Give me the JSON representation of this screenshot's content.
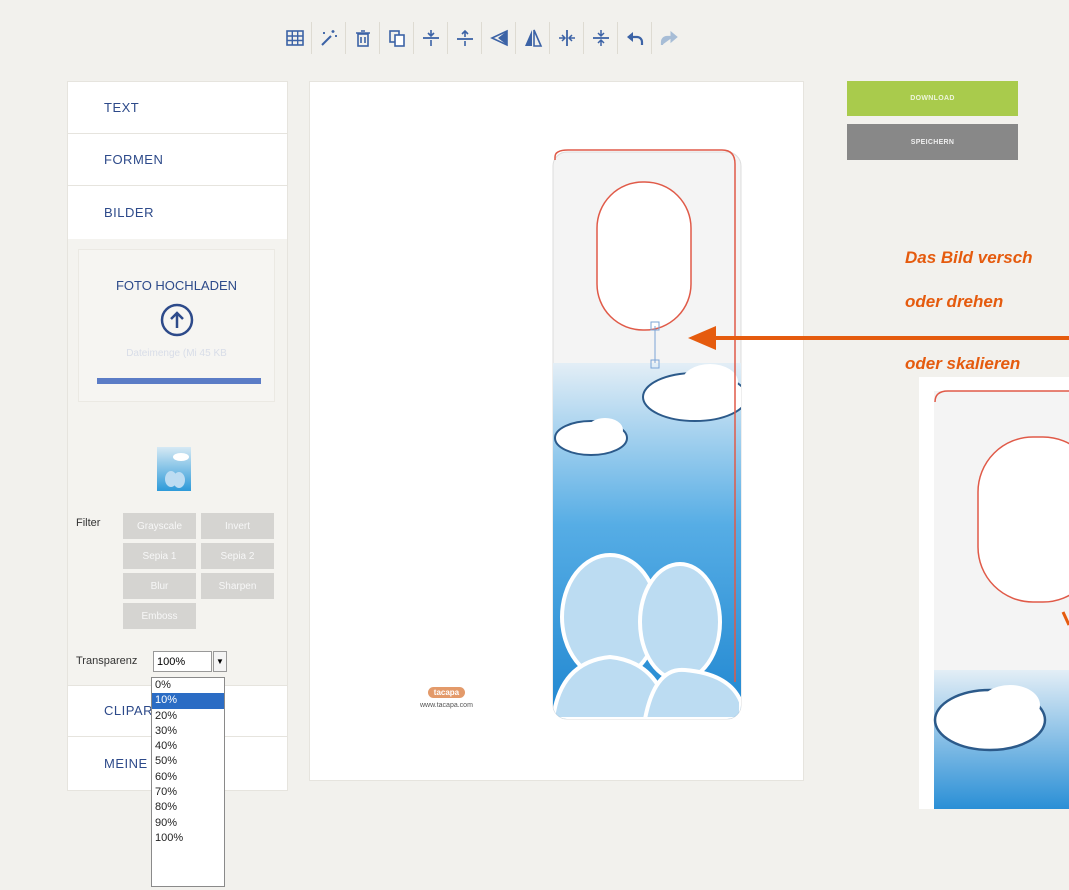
{
  "toolbar": {
    "icons": [
      "grid-icon",
      "magic-wand-icon",
      "trash-icon",
      "copy-icon",
      "align-top-icon",
      "align-bottom-icon",
      "flip-horizontal-icon",
      "flip-vertical-icon",
      "center-horizontal-icon",
      "center-vertical-icon",
      "undo-icon",
      "redo-icon"
    ]
  },
  "sidebar": {
    "menu_top": [
      "TEXT",
      "FORMEN",
      "BILDER"
    ],
    "upload": {
      "title": "FOTO HOCHLADEN",
      "subtitle": "Dateimenge (Mi 45 KB"
    },
    "filter": {
      "label": "Filter",
      "buttons": [
        "Grayscale",
        "Invert",
        "Sepia 1",
        "Sepia 2",
        "Blur",
        "Sharpen",
        "Emboss"
      ]
    },
    "transparency": {
      "label": "Transparenz",
      "value": "100%",
      "options": [
        "0%",
        "10%",
        "20%",
        "30%",
        "40%",
        "50%",
        "60%",
        "70%",
        "80%",
        "90%",
        "100%"
      ],
      "highlighted": "10%"
    },
    "menu_bottom": [
      "CLIPART",
      "MEINE"
    ]
  },
  "canvas": {
    "logo_text": "tacapa",
    "logo_url": "www.tacapa.com"
  },
  "actions": {
    "download": "DOWNLOAD",
    "save": "SPEICHERN"
  },
  "annotation": {
    "line1": "Das Bild versch",
    "line2": "oder drehen",
    "line3": "oder skalieren"
  },
  "colors": {
    "accent": "#2d4a8a",
    "download": "#a9cb4c",
    "save": "#888888",
    "annotation": "#e55b0e",
    "cutline": "#e05a48"
  }
}
